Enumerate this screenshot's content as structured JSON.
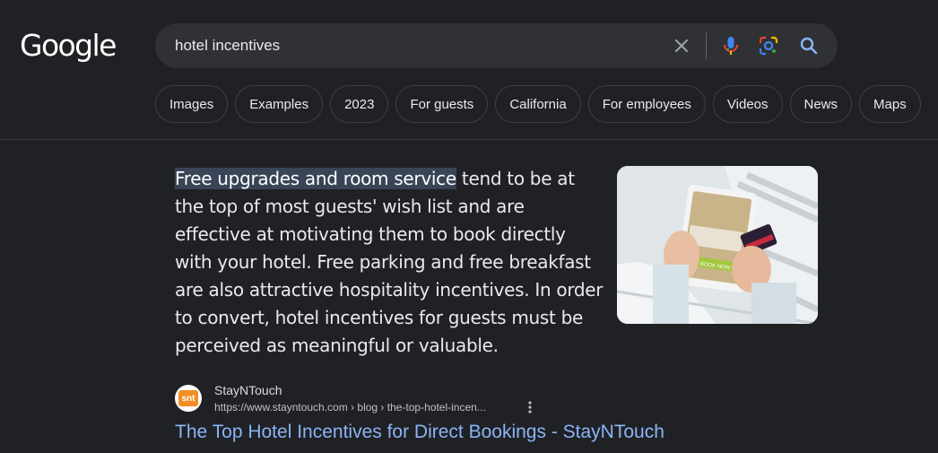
{
  "logo": {
    "text": "Google"
  },
  "search": {
    "query": "hotel incentives"
  },
  "icons": {
    "clear": "close-icon",
    "mic": "microphone-icon",
    "lens": "lens-camera-icon",
    "search": "search-icon",
    "more": "more-vert-icon"
  },
  "colors": {
    "background": "#202124",
    "searchbar": "#303134",
    "link": "#8ab4f8",
    "highlight": "#394457"
  },
  "chips": [
    {
      "label": "Images"
    },
    {
      "label": "Examples"
    },
    {
      "label": "2023"
    },
    {
      "label": "For guests"
    },
    {
      "label": "California"
    },
    {
      "label": "For employees"
    },
    {
      "label": "Videos"
    },
    {
      "label": "News"
    },
    {
      "label": "Maps"
    }
  ],
  "snippet": {
    "highlight": "Free upgrades and room service",
    "body": " tend to be at the top of most guests' wish list and are effective at motivating them to book directly with your hotel. Free parking and free breakfast are also attractive hospitality incentives. In order to convert, hotel incentives for guests must be perceived as meaningful or valuable."
  },
  "thumbnail": {
    "tablet_button": "BOOK NOW"
  },
  "result": {
    "favicon_text": "snt",
    "site_name": "StayNTouch",
    "url": "https://www.stayntouch.com › blog › the-top-hotel-incen...",
    "title": "The Top Hotel Incentives for Direct Bookings - StayNTouch"
  }
}
